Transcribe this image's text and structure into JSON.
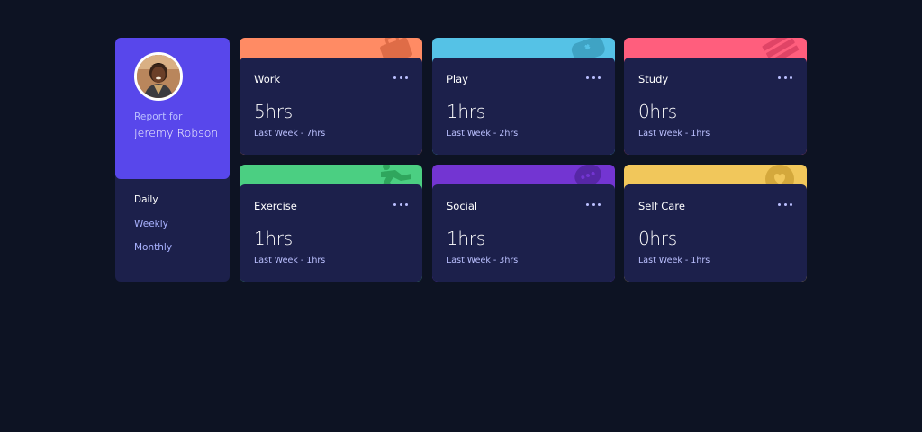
{
  "profile": {
    "report_for": "Report for",
    "name": "Jeremy Robson",
    "avatar_icon": "user-avatar-photo"
  },
  "periods": [
    {
      "label": "Daily",
      "active": true
    },
    {
      "label": "Weekly",
      "active": false
    },
    {
      "label": "Monthly",
      "active": false
    }
  ],
  "activities": [
    {
      "title": "Work",
      "hours": "5hrs",
      "previous": "Last Week - 7hrs",
      "color": "#ff8b64",
      "icon": "briefcase-icon"
    },
    {
      "title": "Play",
      "hours": "1hrs",
      "previous": "Last Week - 2hrs",
      "color": "#55c2e6",
      "icon": "gamepad-icon"
    },
    {
      "title": "Study",
      "hours": "0hrs",
      "previous": "Last Week - 1hrs",
      "color": "#ff5e7d",
      "icon": "book-icon"
    },
    {
      "title": "Exercise",
      "hours": "1hrs",
      "previous": "Last Week - 1hrs",
      "color": "#4bcf82",
      "icon": "running-icon"
    },
    {
      "title": "Social",
      "hours": "1hrs",
      "previous": "Last Week - 3hrs",
      "color": "#7335d2",
      "icon": "chat-bubble-icon"
    },
    {
      "title": "Self Care",
      "hours": "0hrs",
      "previous": "Last Week - 1hrs",
      "color": "#f1c75b",
      "icon": "heart-icon"
    }
  ]
}
